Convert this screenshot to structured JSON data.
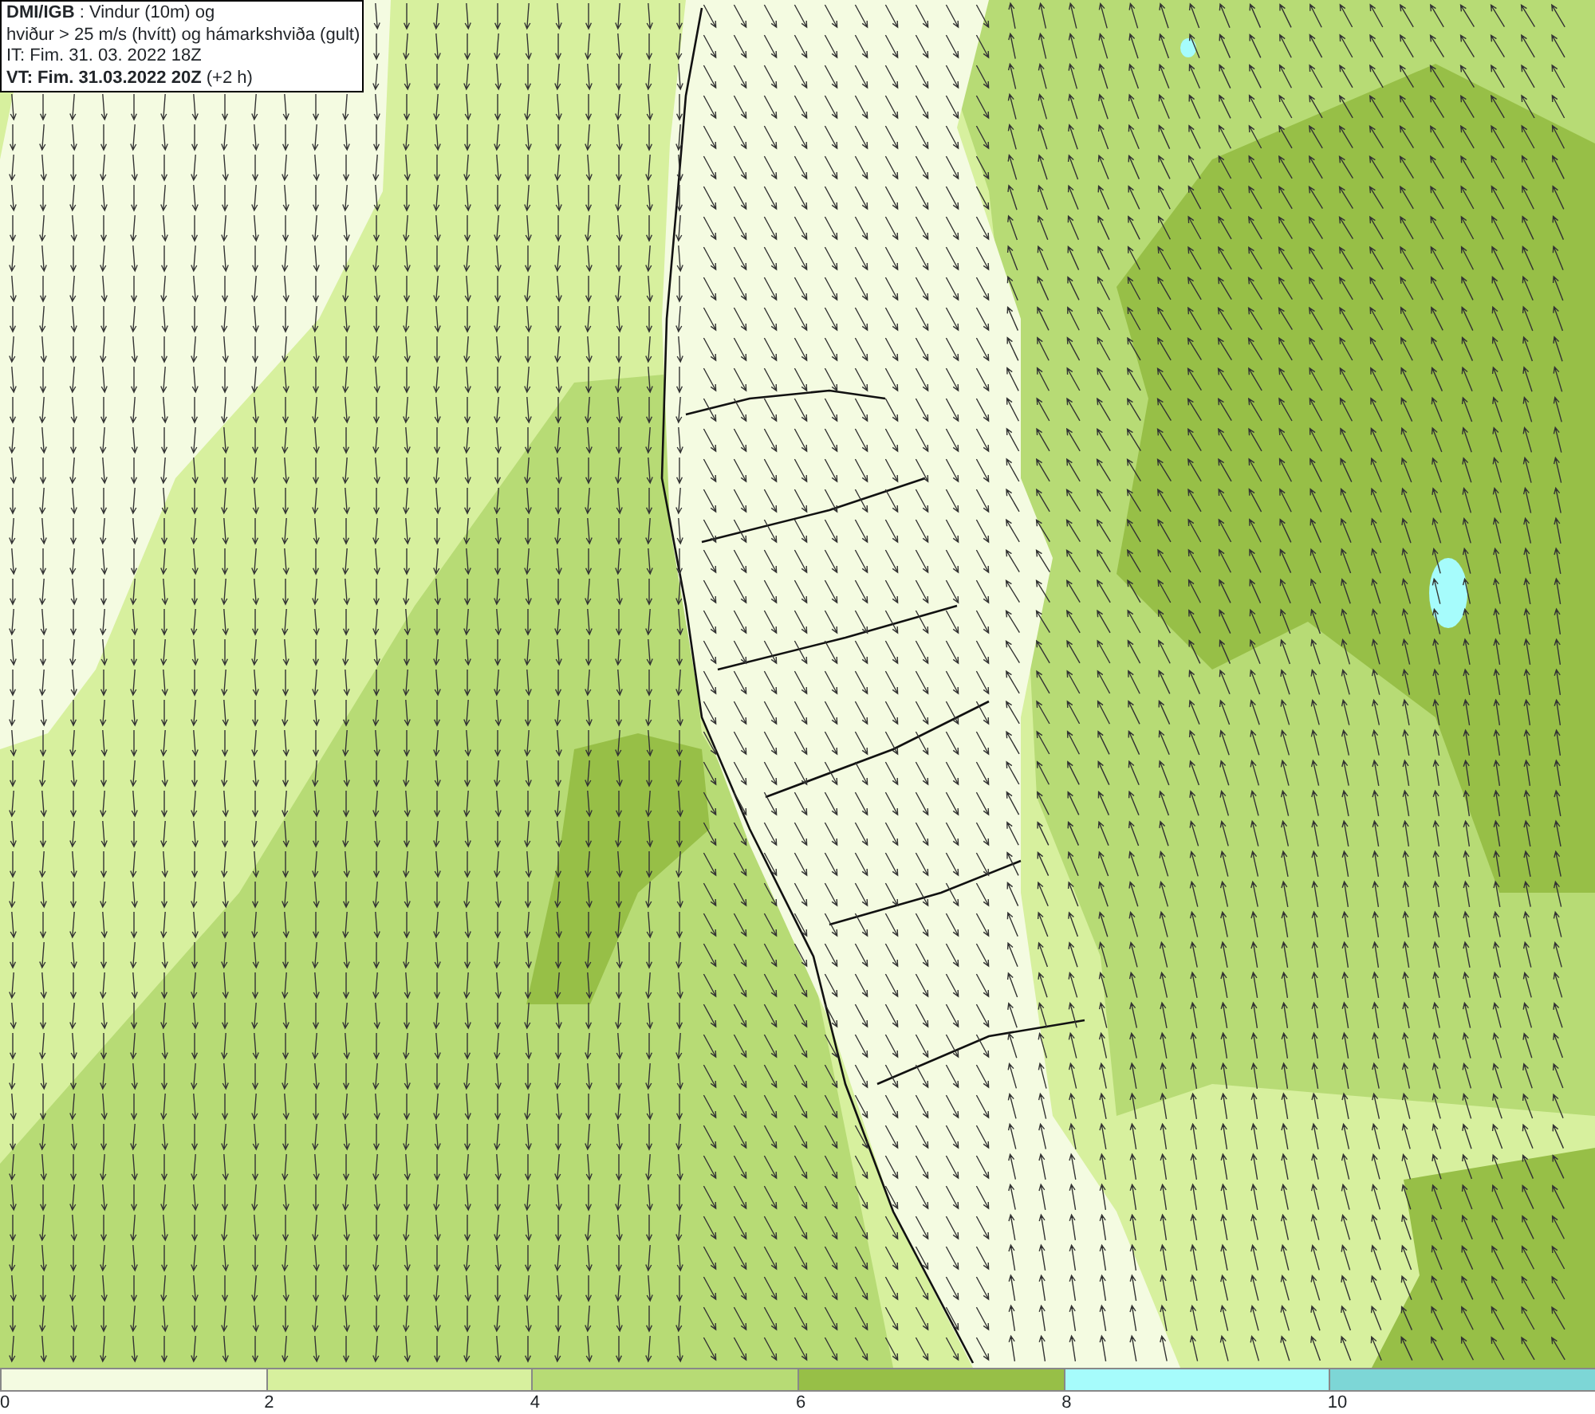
{
  "title_box": {
    "lines": [
      "**DMI/IGB** : Vindur (10m) og",
      "hviður > 25 m/s (hvítt) og hámarkshviða (gult)",
      "IT: Fim. 31. 03. 2022 18Z",
      "**VT: Fim. 31.03.2022 20Z** (+2 h)"
    ]
  },
  "legend": {
    "bins": [
      {
        "color": "#f4fbe1"
      },
      {
        "color": "#d7f09e"
      },
      {
        "color": "#b7db75"
      },
      {
        "color": "#97bf47"
      },
      {
        "color": "#a6fcfc"
      },
      {
        "color": "#7dd6d6"
      }
    ],
    "ticks": [
      "0",
      "2",
      "4",
      "6",
      "8",
      "10"
    ]
  }
}
